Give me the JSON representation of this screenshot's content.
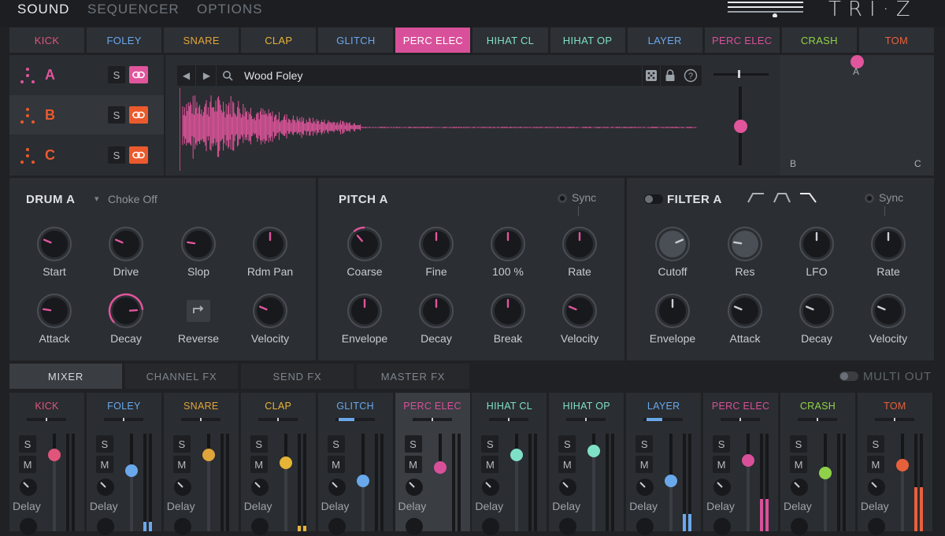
{
  "nav": {
    "tabs": [
      "SOUND",
      "SEQUENCER",
      "OPTIONS"
    ],
    "brand": "TRI·Z"
  },
  "drum_tabs": [
    {
      "label": "KICK",
      "color": "#e0557b"
    },
    {
      "label": "FOLEY",
      "color": "#6aa8ec"
    },
    {
      "label": "SNARE",
      "color": "#e0a53a"
    },
    {
      "label": "CLAP",
      "color": "#e6b537"
    },
    {
      "label": "GLITCH",
      "color": "#6aa8ec"
    },
    {
      "label": "PERC ELEC",
      "color": "#d9509a"
    },
    {
      "label": "HIHAT CL",
      "color": "#7fe0c8"
    },
    {
      "label": "HIHAT OP",
      "color": "#7fe0c8"
    },
    {
      "label": "LAYER",
      "color": "#6aa8ec"
    },
    {
      "label": "PERC ELEC",
      "color": "#d9509a"
    },
    {
      "label": "CRASH",
      "color": "#8fd24a"
    },
    {
      "label": "TOM",
      "color": "#e7603c"
    }
  ],
  "selected_drum": 5,
  "layers": [
    {
      "letter": "A",
      "color": "#e0559c",
      "solo": "S"
    },
    {
      "letter": "B",
      "color": "#ea5a2c",
      "solo": "S"
    },
    {
      "letter": "C",
      "color": "#ea5a2c",
      "solo": "S"
    }
  ],
  "sample": {
    "name": "Wood Foley",
    "waveform_color": "#e0559c"
  },
  "xy_pad": {
    "labels": [
      "A",
      "B",
      "C"
    ],
    "point_color": "#e0559c"
  },
  "drum": {
    "title": "DRUM A",
    "choke": "Choke Off",
    "knobs": [
      {
        "label": "Start",
        "value": 0.25
      },
      {
        "label": "Drive",
        "value": 0.25
      },
      {
        "label": "Slop",
        "value": 0.2
      },
      {
        "label": "Rdm Pan",
        "value": 0.5
      },
      {
        "label": "Attack",
        "value": 0.2
      },
      {
        "label": "Decay",
        "value": 0.82
      },
      {
        "label": "Reverse",
        "value": null
      },
      {
        "label": "Velocity",
        "value": 0.25
      }
    ]
  },
  "pitch": {
    "title": "PITCH A",
    "sync": "Sync",
    "knobs": [
      {
        "label": "Coarse",
        "value": 0.35
      },
      {
        "label": "Fine",
        "value": 0.5
      },
      {
        "label": "100 %",
        "value": 0.5
      },
      {
        "label": "Rate",
        "value": 0.5
      },
      {
        "label": "Envelope",
        "value": 0.5
      },
      {
        "label": "Decay",
        "value": 0.5
      },
      {
        "label": "Break",
        "value": 0.5
      },
      {
        "label": "Velocity",
        "value": 0.25
      }
    ]
  },
  "filter": {
    "title": "FILTER A",
    "sync": "Sync",
    "knobs": [
      {
        "label": "Cutoff",
        "value": 0.75
      },
      {
        "label": "Res",
        "value": 0.2
      },
      {
        "label": "LFO",
        "value": 0.5
      },
      {
        "label": "Rate",
        "value": 0.5
      },
      {
        "label": "Envelope",
        "value": 0.5
      },
      {
        "label": "Attack",
        "value": 0.25
      },
      {
        "label": "Decay",
        "value": 0.25
      },
      {
        "label": "Velocity",
        "value": 0.25
      }
    ]
  },
  "lower_tabs": [
    "MIXER",
    "CHANNEL FX",
    "SEND FX",
    "MASTER FX"
  ],
  "multi_out": "MULTI OUT",
  "mixer": {
    "solo": "S",
    "mute": "M",
    "send_label": "Delay",
    "channels": [
      {
        "name": "KICK",
        "color": "#e0557b",
        "fader": 0.78,
        "meter": 0.0
      },
      {
        "name": "FOLEY",
        "color": "#6aa8ec",
        "fader": 0.62,
        "meter": 0.1
      },
      {
        "name": "SNARE",
        "color": "#e0a53a",
        "fader": 0.78,
        "meter": 0.0
      },
      {
        "name": "CLAP",
        "color": "#e6b537",
        "fader": 0.7,
        "meter": 0.06
      },
      {
        "name": "GLITCH",
        "color": "#6aa8ec",
        "fader": 0.52,
        "meter": 0.0
      },
      {
        "name": "PERC ELEC",
        "color": "#d9509a",
        "fader": 0.65,
        "meter": 0.0
      },
      {
        "name": "HIHAT CL",
        "color": "#7fe0c8",
        "fader": 0.78,
        "meter": 0.0
      },
      {
        "name": "HIHAT OP",
        "color": "#7fe0c8",
        "fader": 0.82,
        "meter": 0.0
      },
      {
        "name": "LAYER",
        "color": "#6aa8ec",
        "fader": 0.52,
        "meter": 0.18
      },
      {
        "name": "PERC ELEC",
        "color": "#d9509a",
        "fader": 0.73,
        "meter": 0.33
      },
      {
        "name": "CRASH",
        "color": "#8fd24a",
        "fader": 0.6,
        "meter": 0.0
      },
      {
        "name": "TOM",
        "color": "#e7603c",
        "fader": 0.68,
        "meter": 0.45
      }
    ]
  }
}
